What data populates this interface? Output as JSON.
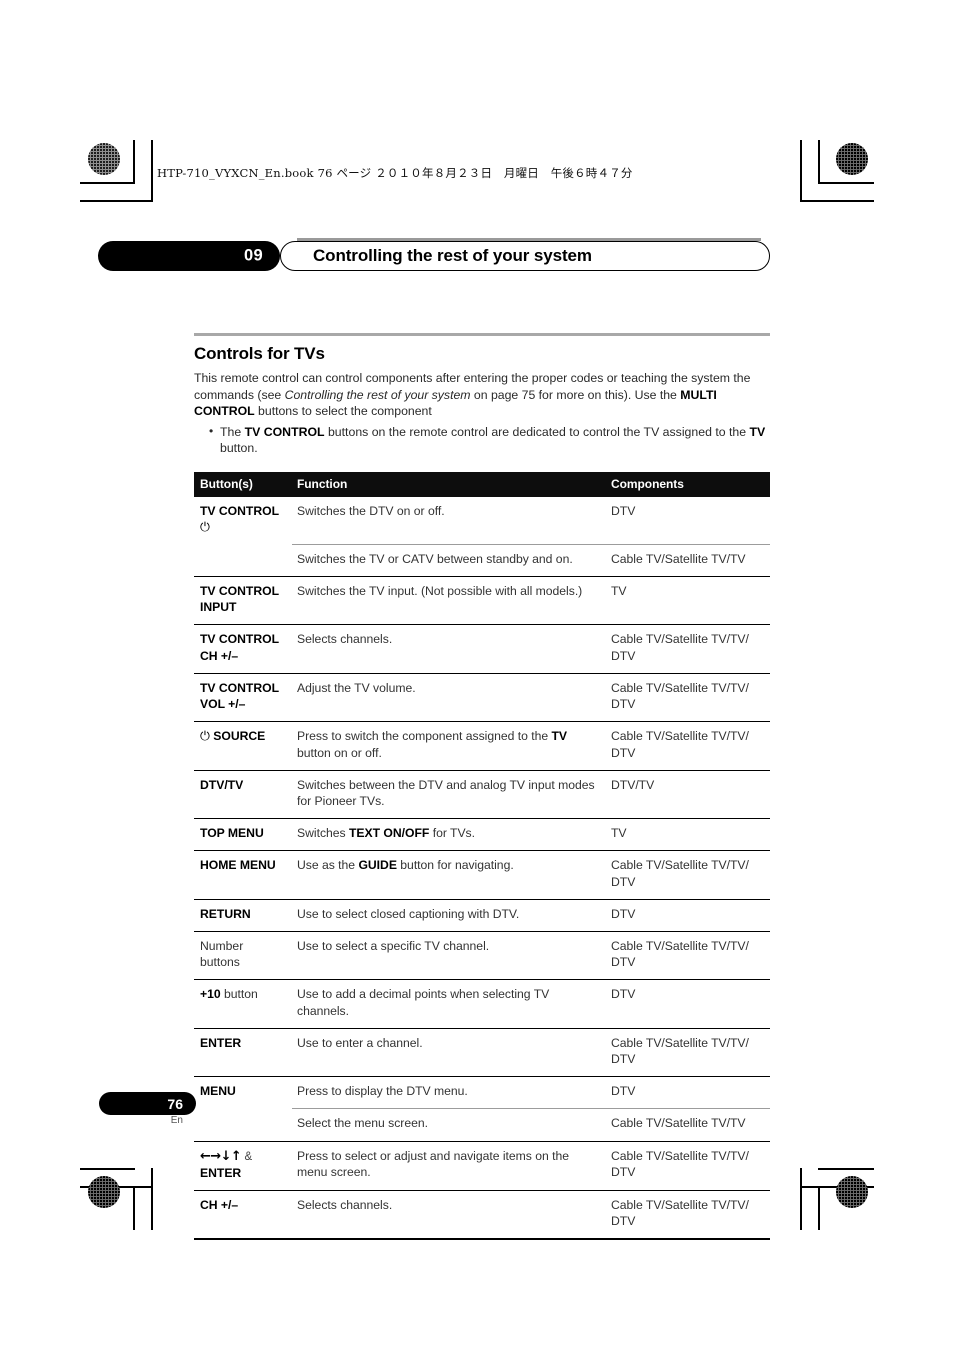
{
  "header": {
    "book_line": "HTP-710_VYXCN_En.book  76 ページ  ２０１０年８月２３日　月曜日　午後６時４７分"
  },
  "chapter": {
    "number": "09",
    "title": "Controlling the rest of your system"
  },
  "section": {
    "title": "Controls for TVs",
    "intro_part1": "This remote control can control components after entering the proper codes or teaching the system the commands (see ",
    "intro_italic": "Controlling the rest of your system",
    "intro_part2": " on page 75 for more on this). Use the ",
    "intro_bold": "MULTI CONTROL",
    "intro_part3": " buttons to select the component",
    "bullet_part1": "The ",
    "bullet_bold1": "TV CONTROL",
    "bullet_part2": " buttons on the remote control are dedicated to control the TV assigned to the ",
    "bullet_bold2": "TV",
    "bullet_part3": " button."
  },
  "table": {
    "headers": {
      "buttons": "Button(s)",
      "function": "Function",
      "components": "Components"
    },
    "rows": [
      {
        "button": "TV CONTROL",
        "button_icon": "power-icon",
        "button_glyph": "⏻",
        "function": "Switches the DTV on or off.",
        "components": "DTV",
        "divider": "none"
      },
      {
        "button": "",
        "function": "Switches the TV or CATV between standby and on.",
        "components": "Cable TV/Satellite TV/TV",
        "divider": "thin"
      },
      {
        "button": "TV CONTROL INPUT",
        "function": "Switches the TV input. (Not possible with all models.)",
        "components": "TV",
        "divider": "thick"
      },
      {
        "button": "TV CONTROL CH +/–",
        "function": "Selects channels.",
        "components": "Cable TV/Satellite TV/TV/ DTV",
        "divider": "thick"
      },
      {
        "button": "TV CONTROL VOL +/–",
        "function": "Adjust the TV volume.",
        "components": "Cable TV/Satellite TV/TV/ DTV",
        "divider": "thick"
      },
      {
        "button": "SOURCE",
        "button_icon": "power-icon",
        "button_glyph": "⏻",
        "function_pre": "Press to switch the component assigned to the ",
        "function_bold": "TV",
        "function_post": " button on or off.",
        "components": "Cable TV/Satellite TV/TV/ DTV",
        "divider": "thick"
      },
      {
        "button": "DTV/TV",
        "function": "Switches between the DTV and analog TV input modes for Pioneer TVs.",
        "components": "DTV/TV",
        "divider": "thick"
      },
      {
        "button": "TOP MENU",
        "function_pre": "Switches ",
        "function_bold": "TEXT ON/OFF",
        "function_post": " for TVs.",
        "components": "TV",
        "divider": "thick"
      },
      {
        "button": "HOME MENU",
        "function_pre": "Use as the ",
        "function_bold": "GUIDE",
        "function_post": " button for navigating.",
        "components": "Cable TV/Satellite TV/TV/ DTV",
        "divider": "thick"
      },
      {
        "button": "RETURN",
        "function": "Use to select closed captioning with DTV.",
        "components": "DTV",
        "divider": "thick"
      },
      {
        "button": "Number buttons",
        "button_weight": "normal",
        "function": "Use to select a specific TV channel.",
        "components": "Cable TV/Satellite TV/TV/ DTV",
        "divider": "thick"
      },
      {
        "button_bold_part": "+10",
        "button_plain_part": " button",
        "function": "Use to add a decimal points when selecting TV channels.",
        "components": "DTV",
        "divider": "thick"
      },
      {
        "button": "ENTER",
        "function": "Use to enter a channel.",
        "components": "Cable TV/Satellite TV/TV/ DTV",
        "divider": "thick"
      },
      {
        "button": "MENU",
        "function": "Press to display the DTV menu.",
        "components": "DTV",
        "divider": "thick"
      },
      {
        "button": "",
        "function": "Select the menu screen.",
        "components": "Cable TV/Satellite TV/TV",
        "divider": "thin"
      },
      {
        "button_arrows": "←→↓↑",
        "button_amp": "&",
        "button_second_line": "ENTER",
        "function": "Press to select or adjust and navigate items on the menu screen.",
        "components": "Cable TV/Satellite TV/TV/ DTV",
        "divider": "thick"
      },
      {
        "button": "CH +/–",
        "function": "Selects channels.",
        "components": "Cable TV/Satellite TV/TV/ DTV",
        "divider": "thick"
      }
    ]
  },
  "footer": {
    "page_number": "76",
    "language": "En"
  },
  "colors": {
    "header_bar": "#0d0d0d",
    "rule": "#a8a8a8",
    "body_text": "#2a2a2a"
  }
}
